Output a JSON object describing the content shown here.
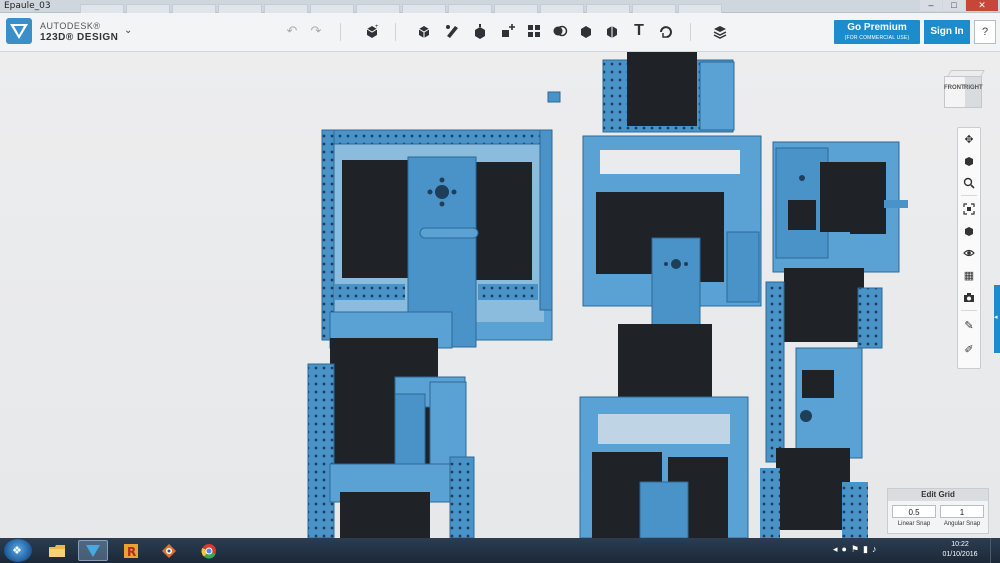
{
  "window": {
    "title": "Epaule_03",
    "controls": [
      "–",
      "□",
      "✕"
    ]
  },
  "brand": {
    "line1": "AUTODESK®",
    "line2": "123D® DESIGN",
    "caret": "⌄"
  },
  "toolbar": {
    "icons": [
      "undo-icon",
      "redo-icon",
      "primitives-icon",
      "sketch-icon",
      "construct-icon",
      "modify-icon",
      "pattern-icon",
      "group-icon",
      "combine-icon",
      "measure-icon",
      "text-icon",
      "snap-icon",
      "material-icon"
    ]
  },
  "buttons": {
    "premium_title": "Go Premium",
    "premium_sub": "(FOR COMMERCIAL USE)",
    "signin": "Sign In",
    "help": "?"
  },
  "viewcube": {
    "front": "FRONT",
    "right": "RIGHT"
  },
  "grid": {
    "title": "Edit Grid",
    "linear_value": "0.5",
    "angular_value": "1",
    "linear_label": "Linear Snap",
    "angular_label": "Angular Snap"
  },
  "taskbar": {
    "time": "10:22",
    "date": "01/10/2016"
  },
  "colors": {
    "accent": "#1d8ccd",
    "model_blue": "#4a93c8",
    "servo": "#1f2226"
  }
}
